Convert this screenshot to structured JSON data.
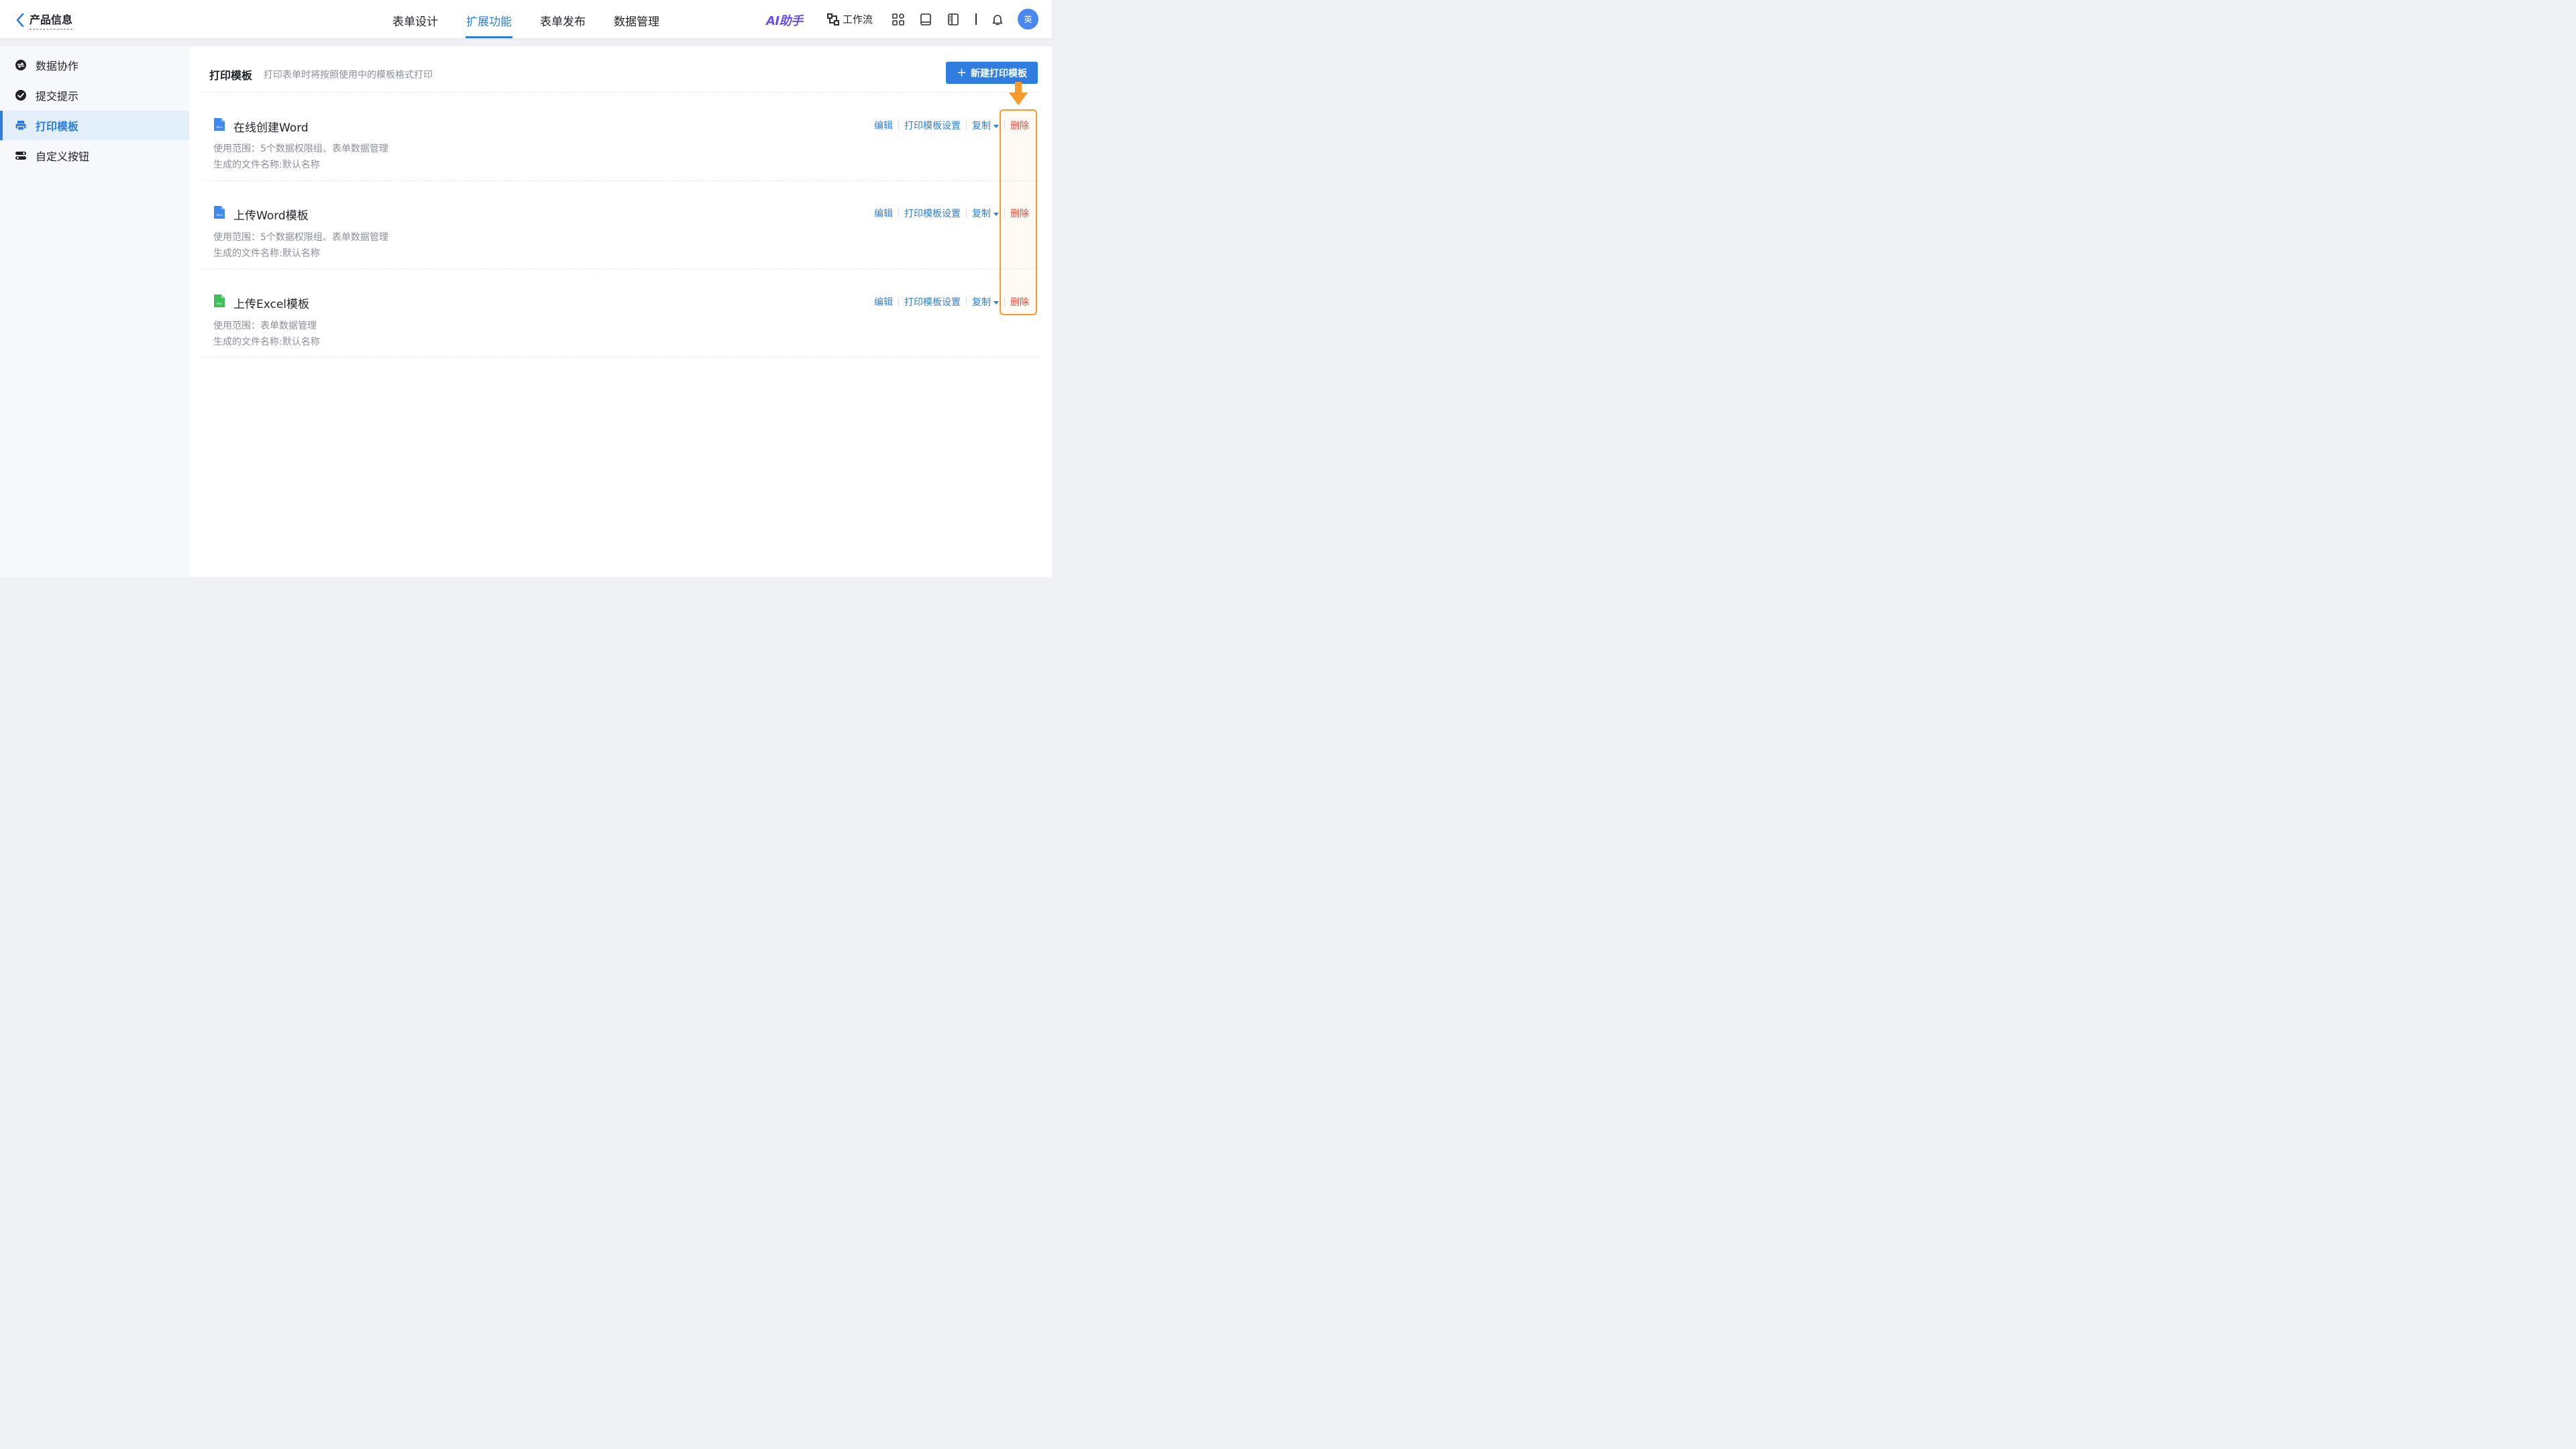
{
  "header": {
    "app_title": "产品信息",
    "tabs": [
      {
        "label": "表单设计",
        "active": false
      },
      {
        "label": "扩展功能",
        "active": true
      },
      {
        "label": "表单发布",
        "active": false
      },
      {
        "label": "数据管理",
        "active": false
      }
    ],
    "ai_label": "AI助手",
    "workflow_label": "工作流",
    "avatar_text": "英",
    "icons": [
      "apps-icon",
      "book-icon",
      "panel-icon",
      "bell-icon"
    ]
  },
  "sidebar": {
    "items": [
      {
        "label": "数据协作",
        "icon": "sync-icon",
        "active": false
      },
      {
        "label": "提交提示",
        "icon": "check-circle-icon",
        "active": false
      },
      {
        "label": "打印模板",
        "icon": "printer-icon",
        "active": true
      },
      {
        "label": "自定义按钮",
        "icon": "toggle-icon",
        "active": false
      }
    ]
  },
  "main": {
    "title": "打印模板",
    "description": "打印表单时将按照使用中的模板格式打印",
    "new_button": "新建打印模板",
    "templates": [
      {
        "name": "在线创建Word",
        "file_type": "docx",
        "scope": "使用范围：5个数据权限组、表单数据管理",
        "filename": "生成的文件名称:默认名称"
      },
      {
        "name": "上传Word模板",
        "file_type": "docx",
        "scope": "使用范围：5个数据权限组、表单数据管理",
        "filename": "生成的文件名称:默认名称"
      },
      {
        "name": "上传Excel模板",
        "file_type": "xlsx",
        "scope": "使用范围：表单数据管理",
        "filename": "生成的文件名称:默认名称"
      }
    ],
    "actions": {
      "edit": "编辑",
      "settings": "打印模板设置",
      "copy": "复制",
      "delete": "删除"
    }
  },
  "colors": {
    "primary": "#2f7de1",
    "danger": "#e8453c",
    "highlight": "#f79a2e",
    "word": "#3d8af0",
    "excel": "#3fbf5a"
  }
}
